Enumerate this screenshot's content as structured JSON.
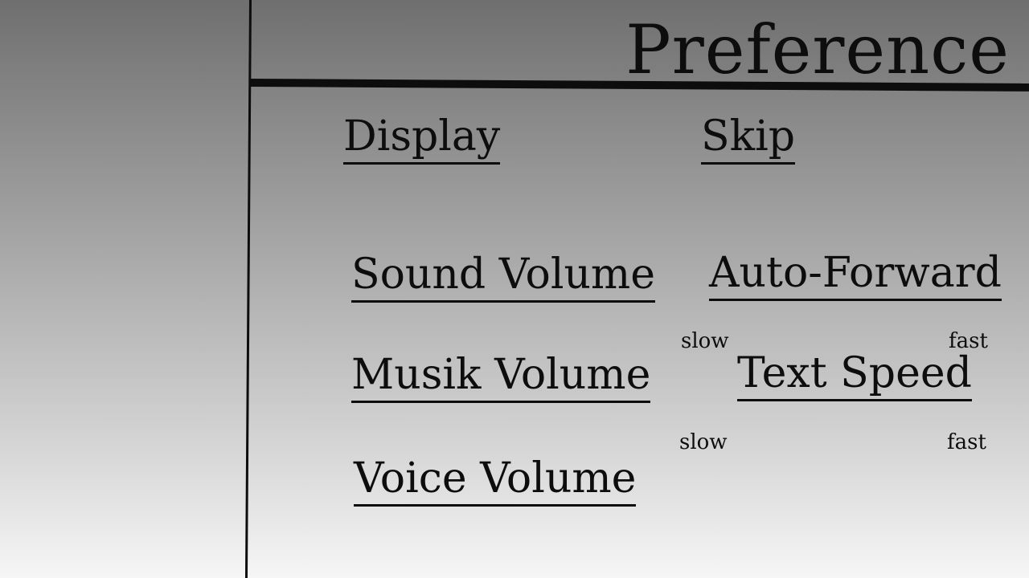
{
  "header": {
    "title": "Preference"
  },
  "menu": {
    "display": "Display",
    "skip": "Skip",
    "sound_volume": "Sound Volume",
    "auto_forward": "Auto-Forward",
    "musik_volume": "Musik Volume",
    "text_speed": "Text Speed",
    "voice_volume": "Voice Volume"
  },
  "auto_forward_speed": {
    "min_label": "slow",
    "max_label": "fast"
  },
  "text_speed": {
    "min_label": "slow",
    "max_label": "fast"
  },
  "colors": {
    "ink": "#0d0d0d",
    "background_top": "#6f6f6f",
    "background_bottom": "#f6f6f6"
  }
}
